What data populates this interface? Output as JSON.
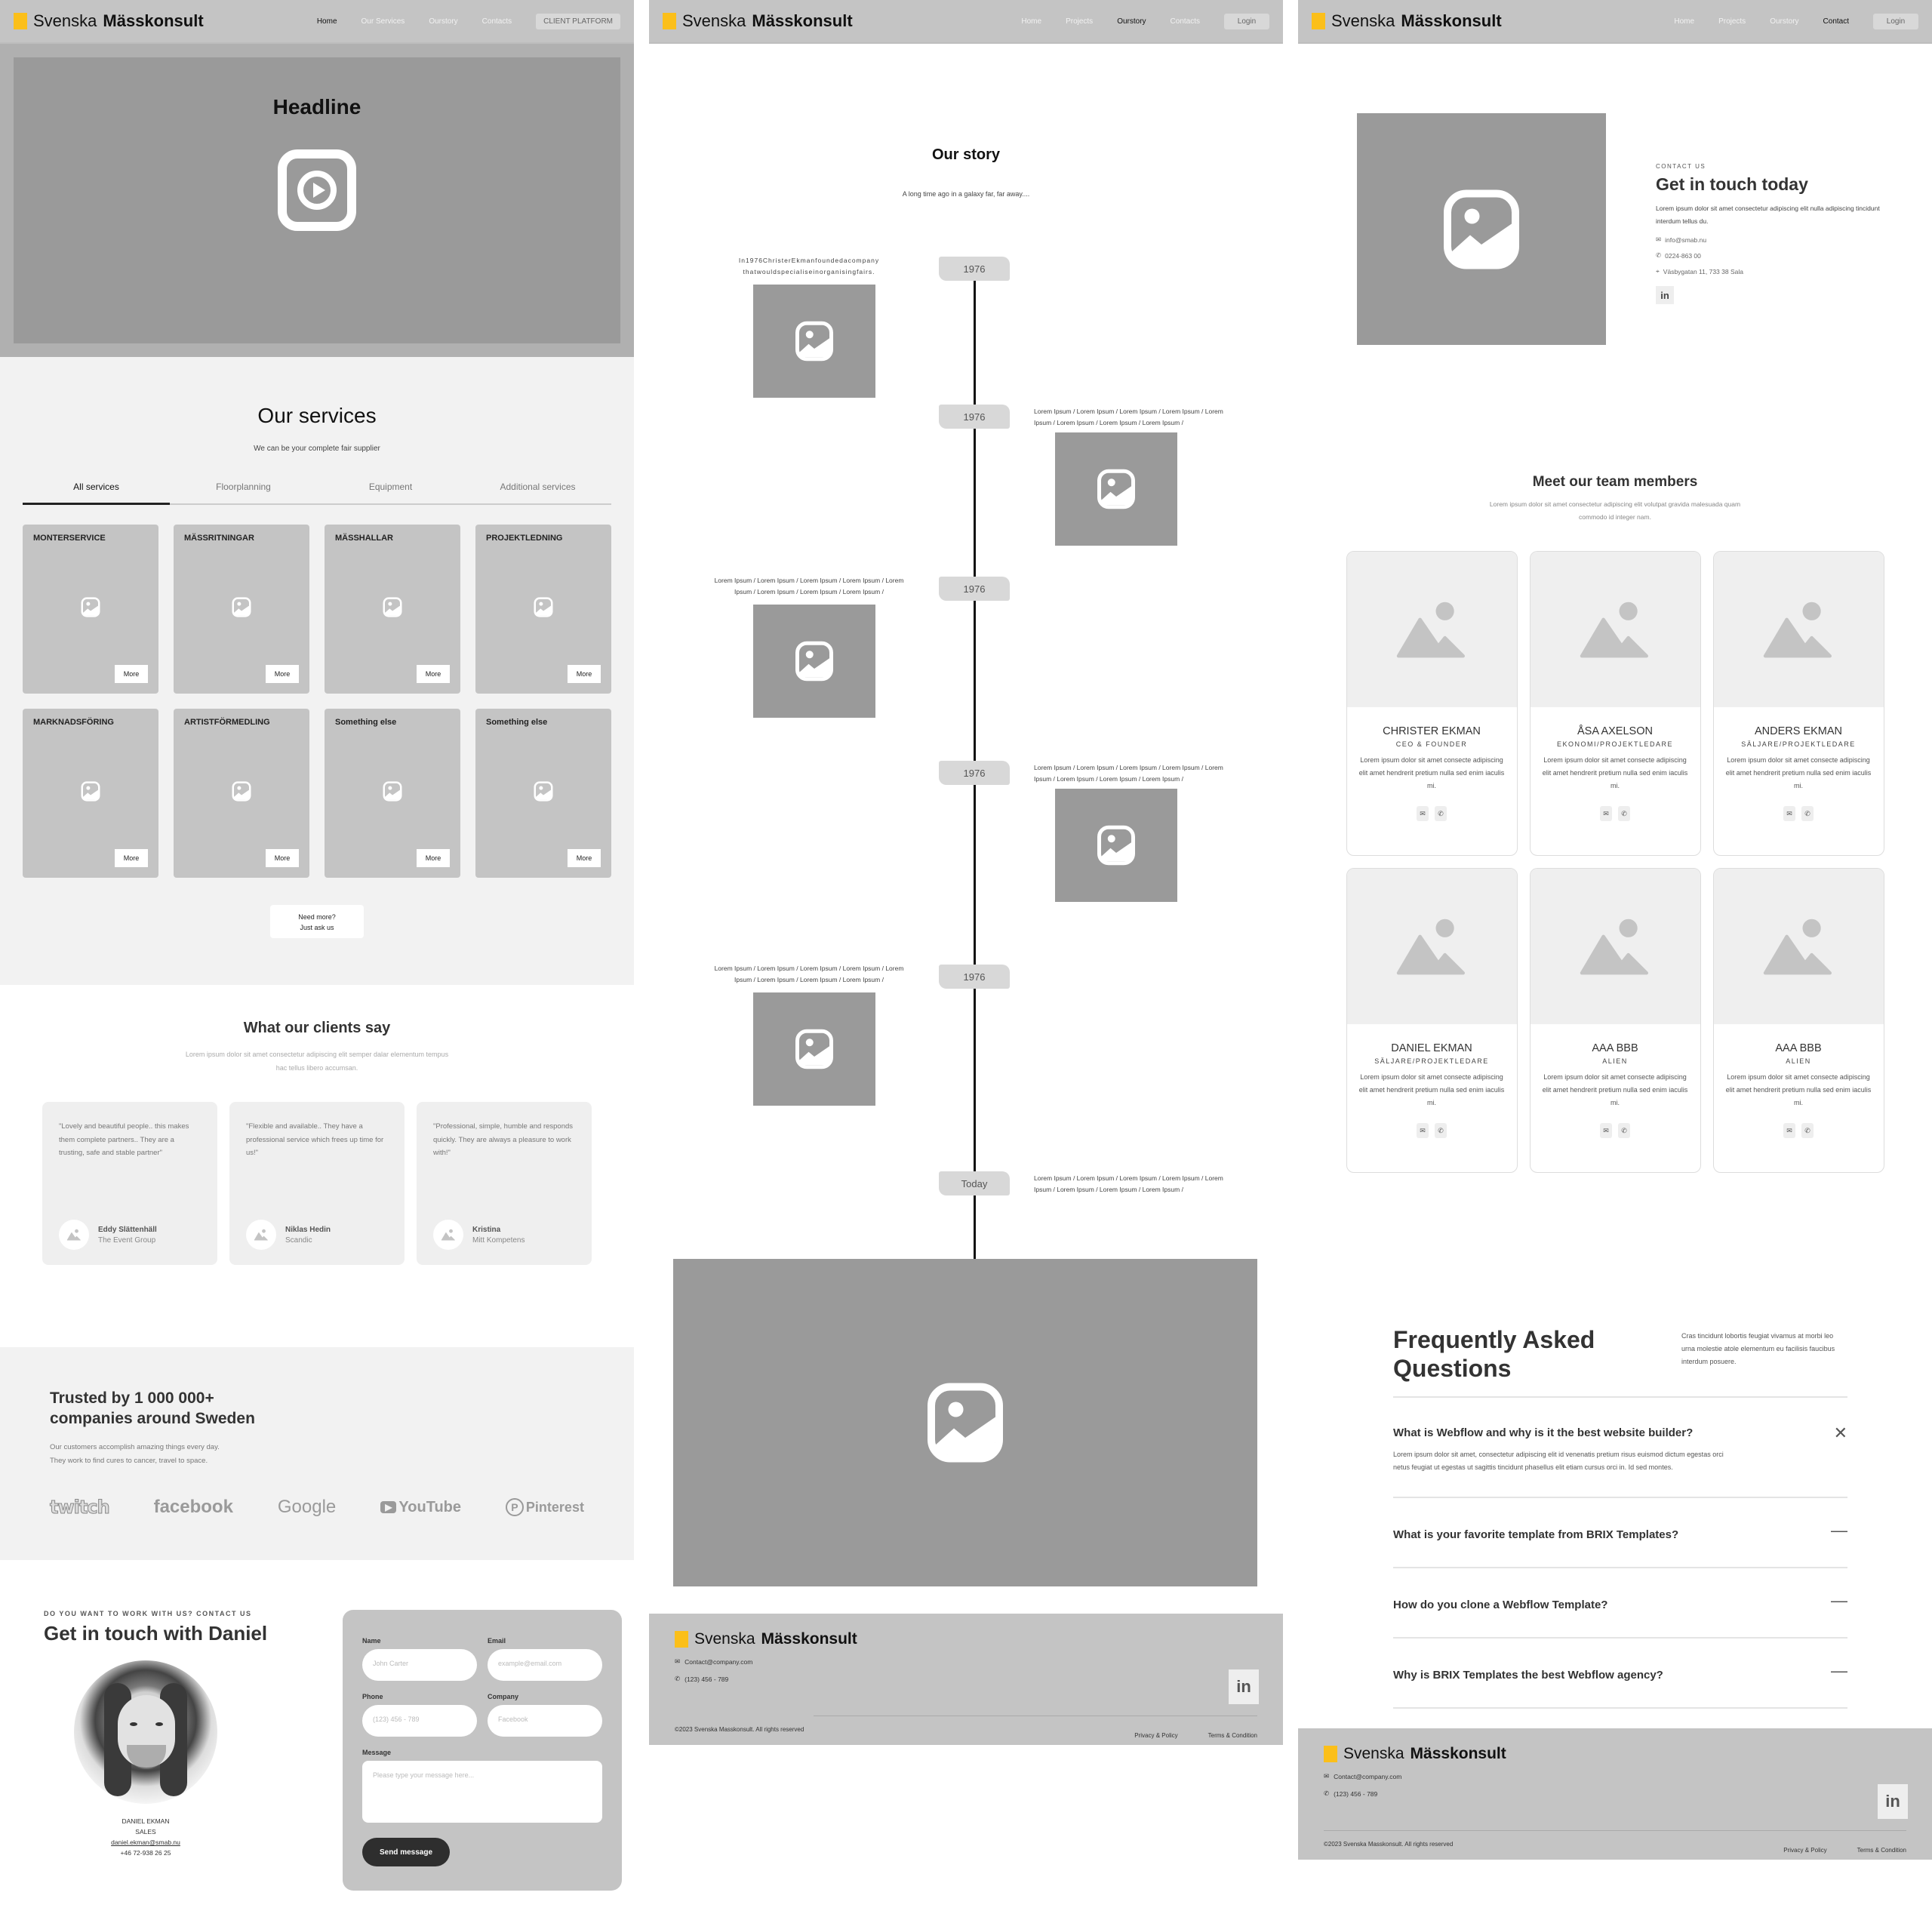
{
  "brand": {
    "name_light": "Svenska",
    "name_bold": "Mässkonsult",
    "accent_color": "#fbbf1a"
  },
  "page1": {
    "nav": {
      "links": [
        "Home",
        "Our Services",
        "Ourstory",
        "Contacts"
      ],
      "active": "Home",
      "button": "CLIENT PLATFORM"
    },
    "hero": {
      "headline": "Headline",
      "icon": "play-icon"
    },
    "services": {
      "title": "Our services",
      "subtitle": "We can be your complete fair supplier",
      "tabs": [
        "All services",
        "Floorplanning",
        "Equipment",
        "Additional services"
      ],
      "active_tab": "All services",
      "cards": [
        {
          "title": "MONTERSERVICE",
          "button": "More"
        },
        {
          "title": "MÄSSRITNINGAR",
          "button": "More"
        },
        {
          "title": "MÄSSHALLAR",
          "button": "More"
        },
        {
          "title": "PROJEKTLEDNING",
          "button": "More"
        },
        {
          "title": "MARKNADSFÖRING",
          "button": "More"
        },
        {
          "title": "ARTISTFÖRMEDLING",
          "button": "More"
        },
        {
          "title": "Something else",
          "button": "More"
        },
        {
          "title": "Something else",
          "button": "More"
        }
      ],
      "need_more_line1": "Need more?",
      "need_more_line2": "Just ask us"
    },
    "clients": {
      "title": "What our clients say",
      "subtitle": "Lorem ipsum dolor sit amet consectetur adipiscing elit semper dalar elementum tempus hac tellus libero accumsan.",
      "testimonials": [
        {
          "quote": "\"Lovely and beautiful people.. this makes them complete partners.. They are a trusting, safe and stable partner\"",
          "name": "Eddy Slättenhäll",
          "company": "The Event Group"
        },
        {
          "quote": "\"Flexible and available.. They have a professional service which frees up time for us!\"",
          "name": "Niklas Hedin",
          "company": "Scandic"
        },
        {
          "quote": "\"Professional, simple, humble and responds quickly. They are always a pleasure to work with!\"",
          "name": "Kristina",
          "company": "Mitt Kompetens"
        }
      ]
    },
    "trusted": {
      "title": "Trusted by 1 000 000+ companies around Sweden",
      "line1": "Our customers accomplish amazing things every day.",
      "line2": "They work to find cures to cancer, travel to space.",
      "brands": [
        "twitch",
        "facebook",
        "Google",
        "YouTube",
        "Pinterest"
      ]
    },
    "contact": {
      "eyebrow": "DO YOU WANT TO WORK WITH US? CONTACT US",
      "title": "Get in touch with Daniel",
      "person_name": "DANIEL EKMAN",
      "person_role": "SALES",
      "person_email": "daniel.ekman@smab.nu",
      "person_phone": "+46 72-938 26 25",
      "form": {
        "name_label": "Name",
        "name_placeholder": "John Carter",
        "email_label": "Email",
        "email_placeholder": "example@email.com",
        "phone_label": "Phone",
        "phone_placeholder": "(123) 456 - 789",
        "company_label": "Company",
        "company_placeholder": "Facebook",
        "message_label": "Message",
        "message_placeholder": "Please type your message here...",
        "submit": "Send message"
      }
    }
  },
  "page2": {
    "nav": {
      "links": [
        "Home",
        "Projects",
        "Ourstory",
        "Contacts"
      ],
      "active": "Ourstory",
      "button": "Login"
    },
    "story": {
      "title": "Our story",
      "tagline": "A long time ago in a galaxy far, far away....",
      "events": [
        {
          "year": "1976",
          "side": "left",
          "text": "In1976ChristerEkmanfoundedacompany thatwouldspecialiseinorganisingfairs."
        },
        {
          "year": "1976",
          "side": "right",
          "text": "Lorem Ipsum / Lorem Ipsum / Lorem Ipsum / Lorem Ipsum / Lorem Ipsum / Lorem Ipsum / Lorem Ipsum / Lorem Ipsum /"
        },
        {
          "year": "1976",
          "side": "left",
          "text": "Lorem Ipsum / Lorem Ipsum / Lorem Ipsum / Lorem Ipsum / Lorem Ipsum / Lorem Ipsum / Lorem Ipsum / Lorem Ipsum /"
        },
        {
          "year": "1976",
          "side": "right",
          "text": "Lorem Ipsum / Lorem Ipsum / Lorem Ipsum / Lorem Ipsum / Lorem Ipsum / Lorem Ipsum / Lorem Ipsum / Lorem Ipsum /"
        },
        {
          "year": "1976",
          "side": "left",
          "text": "Lorem Ipsum / Lorem Ipsum / Lorem Ipsum / Lorem Ipsum / Lorem Ipsum / Lorem Ipsum / Lorem Ipsum / Lorem Ipsum /"
        },
        {
          "year": "Today",
          "side": "right",
          "text": "Lorem Ipsum / Lorem Ipsum / Lorem Ipsum / Lorem Ipsum / Lorem Ipsum / Lorem Ipsum / Lorem Ipsum / Lorem Ipsum /"
        }
      ]
    }
  },
  "page3": {
    "nav": {
      "links": [
        "Home",
        "Projects",
        "Ourstory",
        "Contact"
      ],
      "active": "Contact",
      "button": "Login"
    },
    "contact": {
      "eyebrow": "CONTACT US",
      "title": "Get in touch today",
      "text": "Lorem ipsum dolor sit amet consectetur adipiscing elit nulla adipiscing tincidunt interdum tellus du.",
      "email": "info@smab.nu",
      "phone": "0224-863 00",
      "address": "Väsbygatan 11, 733 38 Sala",
      "social": "in"
    },
    "team": {
      "title": "Meet our team members",
      "subtitle": "Lorem ipsum dolor sit amet consectetur adipiscing elit volutpat gravida malesuada quam commodo id integer nam.",
      "members": [
        {
          "name": "CHRISTER EKMAN",
          "role": "CEO & FOUNDER",
          "bio": "Lorem ipsum dolor sit amet consecte adipiscing elit amet hendrerit pretium nulla sed enim iaculis mi."
        },
        {
          "name": "ÅSA AXELSON",
          "role": "EKONOMI/PROJEKTLEDARE",
          "bio": "Lorem ipsum dolor sit amet consecte adipiscing elit amet hendrerit pretium nulla sed enim iaculis mi."
        },
        {
          "name": "ANDERS EKMAN",
          "role": "SÄLJARE/PROJEKTLEDARE",
          "bio": "Lorem ipsum dolor sit amet consecte adipiscing elit amet hendrerit pretium nulla sed enim iaculis mi."
        },
        {
          "name": "DANIEL EKMAN",
          "role": "SÄLJARE/PROJEKTLEDARE",
          "bio": "Lorem ipsum dolor sit amet consecte adipiscing elit amet hendrerit pretium nulla sed enim iaculis mi."
        },
        {
          "name": "AAA BBB",
          "role": "ALIEN",
          "bio": "Lorem ipsum dolor sit amet consecte adipiscing elit amet hendrerit pretium nulla sed enim iaculis mi."
        },
        {
          "name": "AAA BBB",
          "role": "ALIEN",
          "bio": "Lorem ipsum dolor sit amet consecte adipiscing elit amet hendrerit pretium nulla sed enim iaculis mi."
        }
      ]
    },
    "faq": {
      "title": "Frequently Asked Questions",
      "intro": "Cras tincidunt lobortis feugiat vivamus at morbi leo urna molestie atole elementum eu facilisis faucibus interdum posuere.",
      "items": [
        {
          "q": "What is Webflow and why is it the best website builder?",
          "a": "Lorem ipsum dolor sit amet, consectetur adipiscing elit id venenatis pretium risus euismod dictum egestas orci netus feugiat ut egestas ut sagittis tincidunt phasellus elit etiam cursus orci in. Id sed montes.",
          "open": true
        },
        {
          "q": "What is your favorite template from BRIX Templates?",
          "open": false
        },
        {
          "q": "How do you clone a Webflow Template?",
          "open": false
        },
        {
          "q": "Why is BRIX Templates the best Webflow agency?",
          "open": false
        }
      ]
    }
  },
  "footer": {
    "email": "Contact@company.com",
    "phone": "(123) 456 - 789",
    "copyright": "©2023 Svenska Masskonsult. All rights reserved",
    "privacy": "Privacy & Policy",
    "terms": "Terms & Condition",
    "social": "in"
  }
}
